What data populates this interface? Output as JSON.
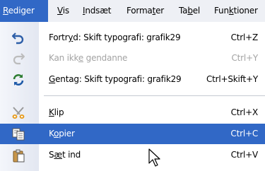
{
  "menubar": {
    "items": [
      {
        "pre": "",
        "key": "R",
        "post": "ediger"
      },
      {
        "pre": "",
        "key": "V",
        "post": "is"
      },
      {
        "pre": "",
        "key": "I",
        "post": "ndsæt"
      },
      {
        "pre": "Forma",
        "key": "t",
        "post": "er"
      },
      {
        "pre": "Ta",
        "key": "b",
        "post": "el"
      },
      {
        "pre": "Fun",
        "key": "k",
        "post": "tioner"
      }
    ]
  },
  "menu": {
    "items": [
      {
        "pre": "Fortr",
        "key": "y",
        "post": "d: Skift typografi: grafik29",
        "shortcut": "Ctrl+Z",
        "icon": "undo-icon",
        "enabled": true
      },
      {
        "pre": "Kan ikk",
        "key": "e",
        "post": " gendanne",
        "shortcut": "Ctrl+Y",
        "icon": "redo-icon",
        "enabled": false
      },
      {
        "pre": "",
        "key": "G",
        "post": "entag: Skift typografi: grafik29",
        "shortcut": "Ctrl+Skift+Y",
        "icon": "repeat-icon",
        "enabled": true
      },
      {
        "pre": "",
        "key": "K",
        "post": "lip",
        "shortcut": "Ctrl+X",
        "icon": "scissors-icon",
        "enabled": true
      },
      {
        "pre": "K",
        "key": "o",
        "post": "pier",
        "shortcut": "Ctrl+C",
        "icon": "copy-icon",
        "enabled": true,
        "selected": true
      },
      {
        "pre": "S",
        "key": "æ",
        "post": "t ind",
        "shortcut": "Ctrl+V",
        "icon": "paste-icon",
        "enabled": true
      }
    ]
  },
  "colors": {
    "highlight": "#3168c6",
    "disabled_text": "#a3a3a3"
  }
}
